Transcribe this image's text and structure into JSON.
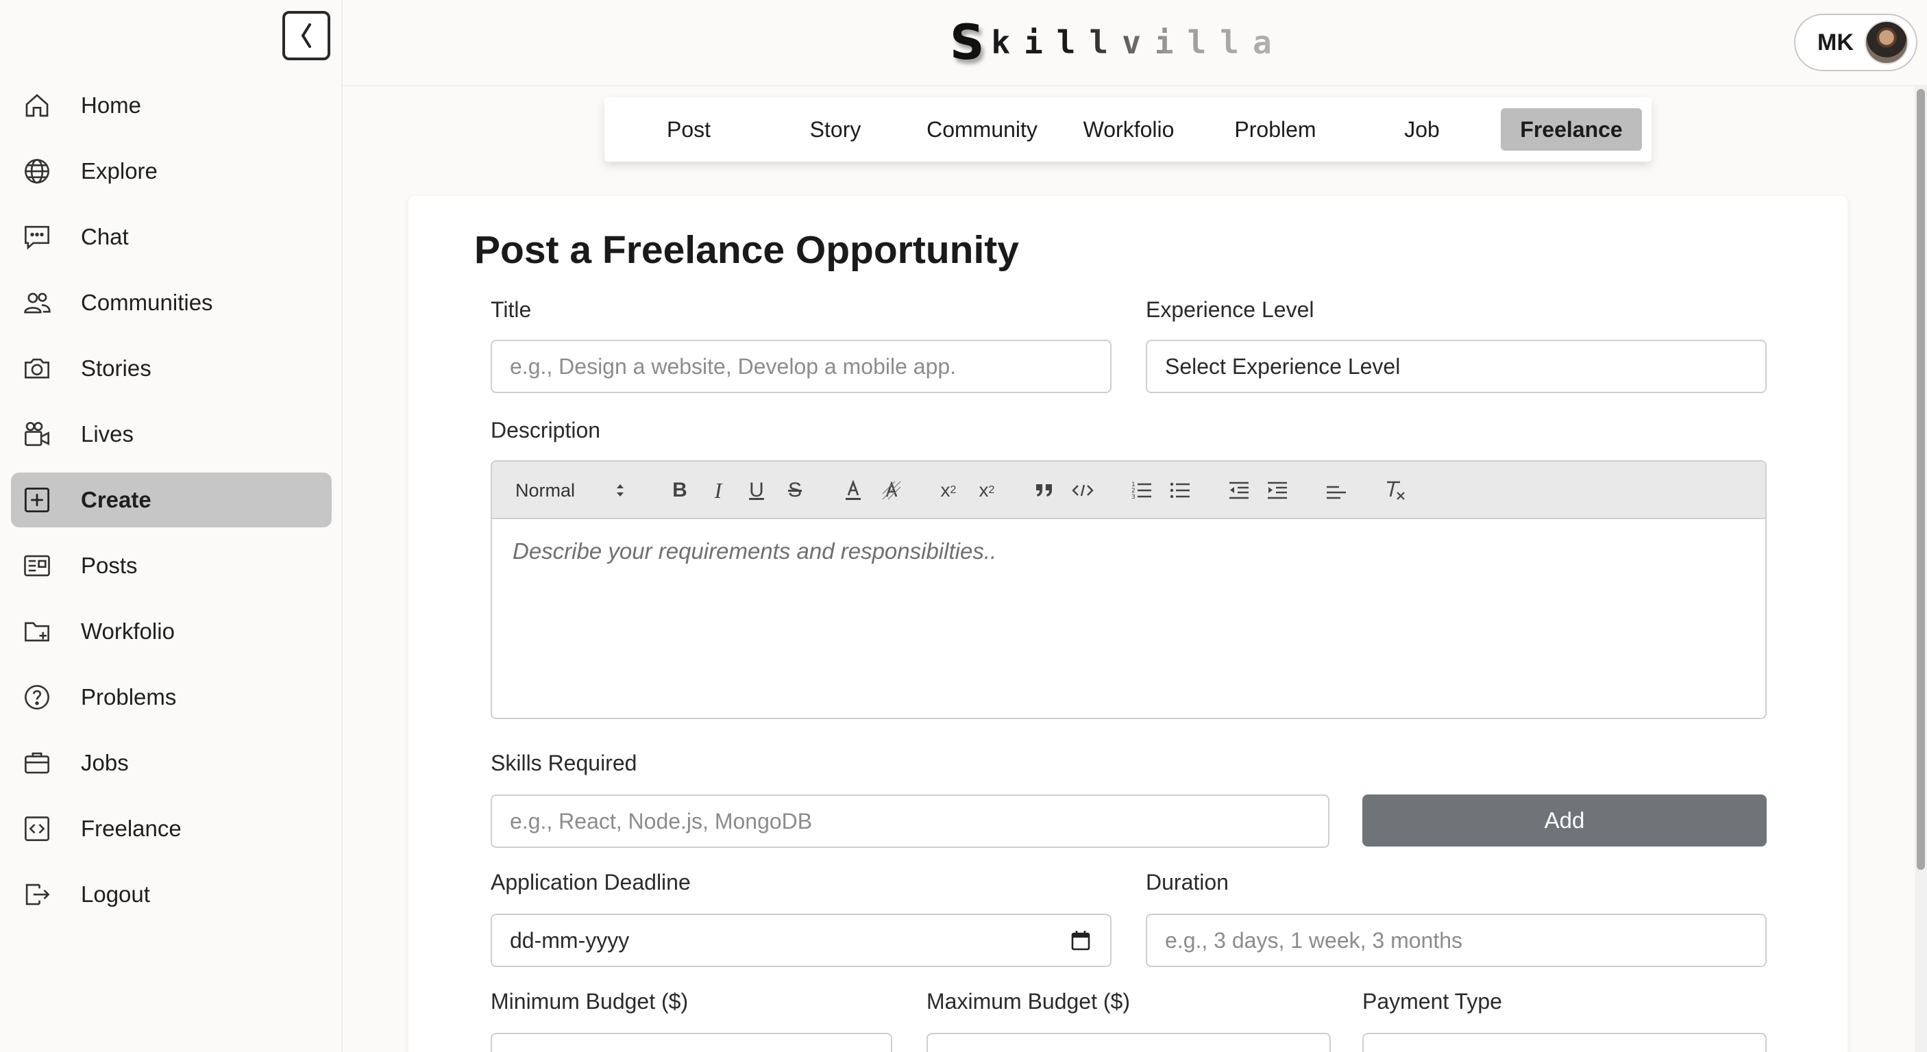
{
  "app": {
    "logo_initial": "S",
    "logo_rest": "killvilla"
  },
  "profile": {
    "initials": "MK"
  },
  "sidebar": {
    "items": [
      {
        "label": "Home",
        "icon": "home-icon"
      },
      {
        "label": "Explore",
        "icon": "globe-icon"
      },
      {
        "label": "Chat",
        "icon": "chat-icon"
      },
      {
        "label": "Communities",
        "icon": "users-icon"
      },
      {
        "label": "Stories",
        "icon": "camera-icon"
      },
      {
        "label": "Lives",
        "icon": "video-icon"
      },
      {
        "label": "Create",
        "icon": "plus-square-icon",
        "active": true
      },
      {
        "label": "Posts",
        "icon": "newspaper-icon"
      },
      {
        "label": "Workfolio",
        "icon": "folder-plus-icon"
      },
      {
        "label": "Problems",
        "icon": "question-circle-icon"
      },
      {
        "label": "Jobs",
        "icon": "briefcase-icon"
      },
      {
        "label": "Freelance",
        "icon": "code-square-icon"
      },
      {
        "label": "Logout",
        "icon": "logout-icon"
      }
    ]
  },
  "tabs": [
    {
      "label": "Post"
    },
    {
      "label": "Story"
    },
    {
      "label": "Community"
    },
    {
      "label": "Workfolio"
    },
    {
      "label": "Problem"
    },
    {
      "label": "Job"
    },
    {
      "label": "Freelance",
      "active": true
    }
  ],
  "form": {
    "heading": "Post a Freelance Opportunity",
    "title_label": "Title",
    "title_placeholder": "e.g., Design a website, Develop a mobile app.",
    "experience_label": "Experience Level",
    "experience_value": "Select Experience Level",
    "description_label": "Description",
    "editor_format": "Normal",
    "description_placeholder": "Describe your requirements and responsibilties..",
    "skills_label": "Skills Required",
    "skills_placeholder": "e.g., React, Node.js, MongoDB",
    "add_label": "Add",
    "deadline_label": "Application Deadline",
    "deadline_value": "dd-mm-yyyy",
    "duration_label": "Duration",
    "duration_placeholder": "e.g., 3 days, 1 week, 3 months",
    "min_budget_label": "Minimum Budget ($)",
    "max_budget_label": "Maximum Budget ($)",
    "payment_type_label": "Payment Type"
  },
  "colors": {
    "active_nav": "#c6c6c6",
    "active_tab": "#bdbdbd",
    "add_button": "#6f7478"
  }
}
